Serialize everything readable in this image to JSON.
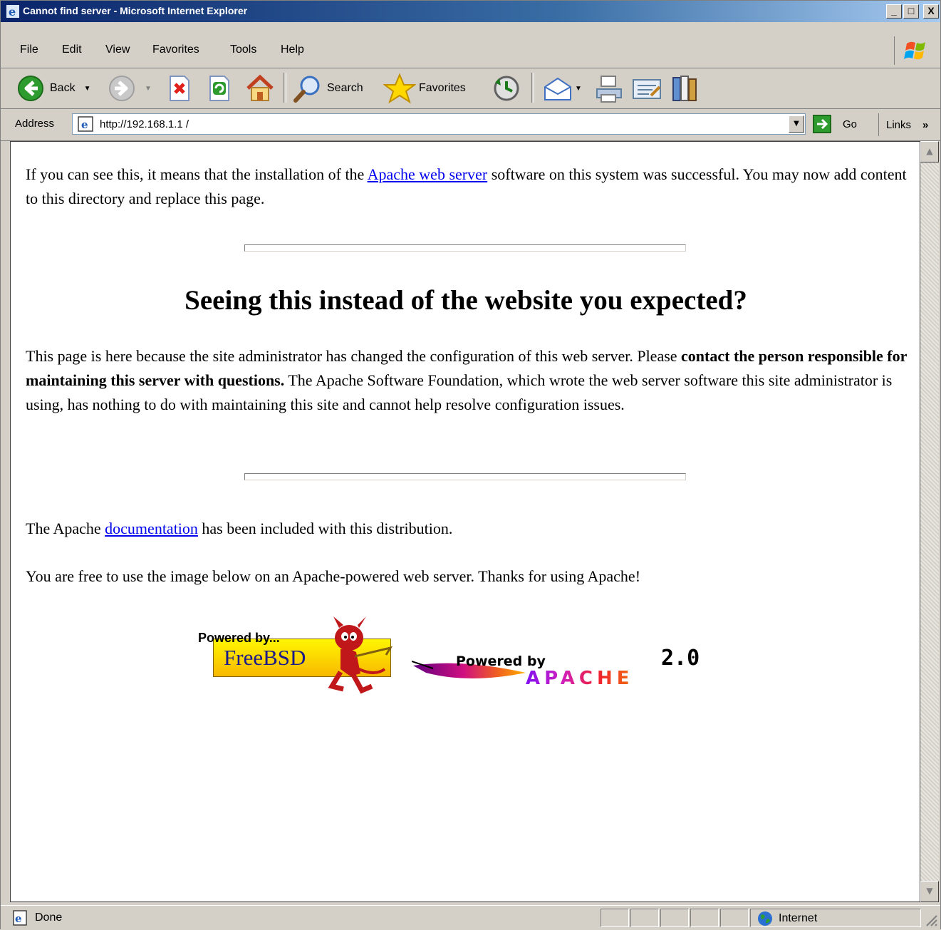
{
  "window": {
    "title": "Cannot find server - Microsoft Internet Explorer",
    "min_label": "_",
    "max_label": "□",
    "close_label": "X"
  },
  "menu": [
    "File",
    "Edit",
    "View",
    "Favorites",
    "Tools",
    "Help"
  ],
  "toolbar": {
    "back_label": "Back",
    "search_label": "Search",
    "favorites_label": "Favorites"
  },
  "address": {
    "label": "Address",
    "url": "http://192.168.1.1 /",
    "go_label": "Go",
    "links_label": "Links",
    "links_chevron": "»"
  },
  "page": {
    "intro_before": "If you can see this, it means that the installation of the ",
    "intro_link": "Apache web server",
    "intro_after": " software on this system was successful. You may now add content to this directory and replace this page.",
    "heading": "Seeing this instead of the website you expected?",
    "para2_before": "This page is here because the site administrator has changed the configuration of this web server. Please ",
    "para2_bold": "contact the person responsible for maintaining this server with questions.",
    "para2_after": " The Apache Software Foundation, which wrote the web server software this site administrator is using, has nothing to do with maintaining this site and cannot help resolve configuration issues.",
    "docs_before": "The Apache ",
    "docs_link": "documentation",
    "docs_after": " has been included with this distribution.",
    "free_text": "You are free to use the image below on an Apache-powered web server. Thanks for using Apache!",
    "freebsd_logo": {
      "top": "Powered by...",
      "name": "FreeBSD"
    },
    "apache_logo": {
      "top": "Powered by",
      "name": "APACHE",
      "version": "2.0"
    }
  },
  "status": {
    "text": "Done",
    "zone": "Internet"
  },
  "colors": {
    "title_gradient_start": "#0a246a",
    "link": "#0000ee",
    "chrome": "#d4d0c8"
  }
}
